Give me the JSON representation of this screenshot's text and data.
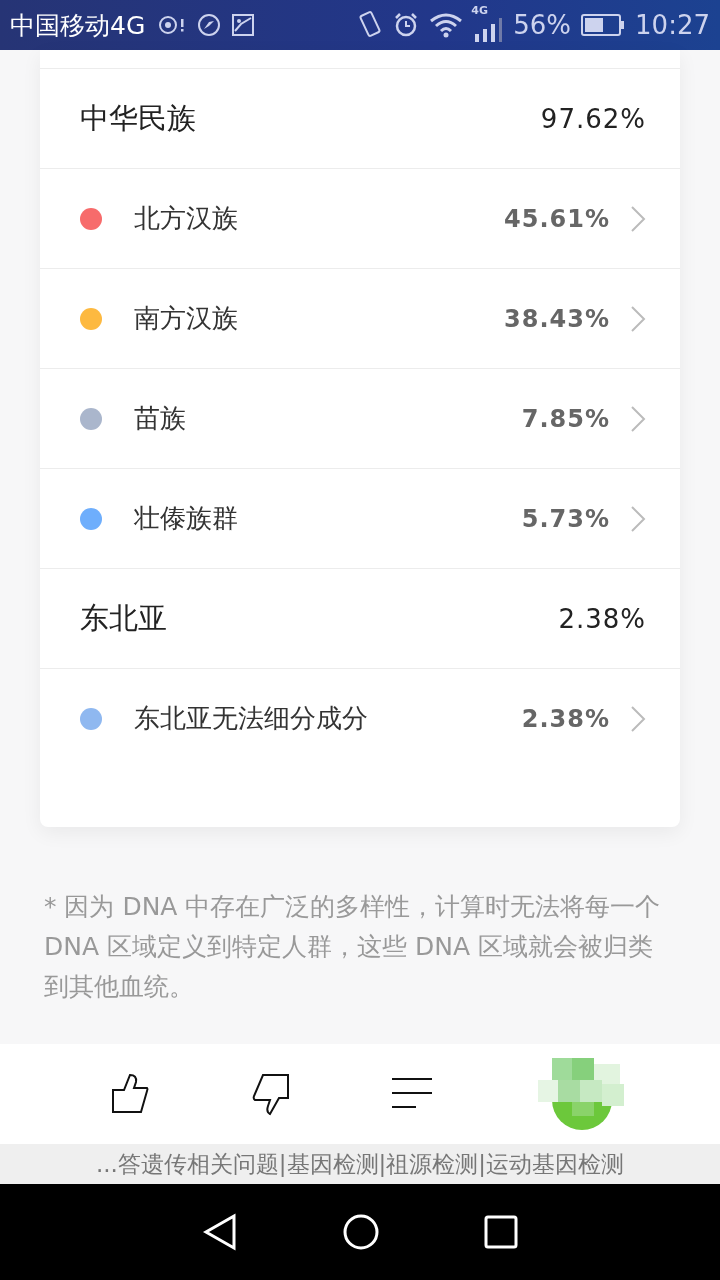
{
  "status_bar": {
    "carrier": "中国移动4G",
    "network_badge": "4G",
    "battery": "56%",
    "time": "10:27"
  },
  "breakdown": [
    {
      "kind": "group",
      "name": "中华民族",
      "percent": "97.62%"
    },
    {
      "kind": "sub",
      "name": "北方汉族",
      "percent": "45.61%",
      "color": "#f76b6b"
    },
    {
      "kind": "sub",
      "name": "南方汉族",
      "percent": "38.43%",
      "color": "#fdb940"
    },
    {
      "kind": "sub",
      "name": "苗族",
      "percent": "7.85%",
      "color": "#aab6cc"
    },
    {
      "kind": "sub",
      "name": "壮傣族群",
      "percent": "5.73%",
      "color": "#6eaefc"
    },
    {
      "kind": "group",
      "name": "东北亚",
      "percent": "2.38%"
    },
    {
      "kind": "sub",
      "name": "东北亚无法细分成分",
      "percent": "2.38%",
      "color": "#8fb8f0"
    }
  ],
  "footnote": "* 因为 DNA 中存在广泛的多样性，计算时无法将每一个 DNA 区域定义到特定人群，这些 DNA 区域就会被归类到其他血统。",
  "ticker": "...答遗传相关问题|基因检测|祖源检测|运动基因检测"
}
